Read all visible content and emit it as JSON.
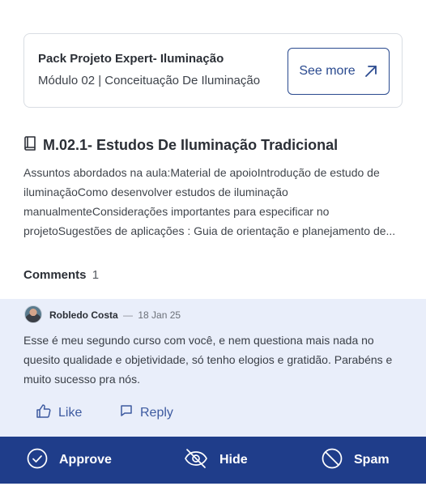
{
  "course": {
    "title": "Pack Projeto Expert- Iluminação",
    "module": "Módulo 02 | Conceituação De Iluminação",
    "see_more_label": "See more"
  },
  "lesson": {
    "icon": "book-icon",
    "title": "M.02.1- Estudos De Iluminação Tradicional",
    "description": "Assuntos abordados na aula:Material de apoioIntrodução de estudo de iluminaçãoComo desenvolver estudos de iluminação manualmenteConsiderações importantes para especificar no projetoSugestões de aplicações : Guia de orientação e planejamento de..."
  },
  "comments": {
    "label": "Comments",
    "count": "1",
    "items": [
      {
        "author": "Robledo Costa",
        "separator": "—",
        "date": "18 Jan 25",
        "text": "Esse é meu segundo curso com você, e nem questiona mais nada no quesito qualidade e objetividade, só tenho elogios e gratidão. Parabéns e muito sucesso pra nós.",
        "like_label": "Like",
        "reply_label": "Reply"
      }
    ]
  },
  "moderation": {
    "approve_label": "Approve",
    "hide_label": "Hide",
    "spam_label": "Spam"
  },
  "colors": {
    "accent": "#2a4a8f",
    "bar_background": "#1f3d8a",
    "comment_background": "#e9eefa"
  }
}
